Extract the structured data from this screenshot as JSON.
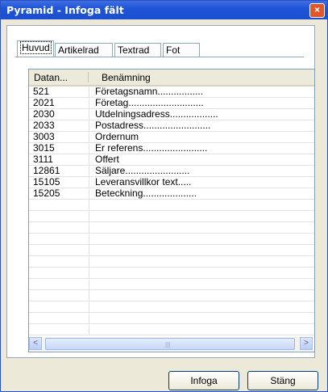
{
  "window": {
    "title": "Pyramid - Infoga fält",
    "close_label": "×"
  },
  "tabs": [
    {
      "label": "Huvud",
      "active": true
    },
    {
      "label": "Artikelrad",
      "active": false
    },
    {
      "label": "Textrad",
      "active": false
    },
    {
      "label": "Fot",
      "active": false
    }
  ],
  "table": {
    "headers": [
      "Datan...",
      "Benämning"
    ],
    "rows": [
      {
        "id": "521",
        "name": "Företagsnamn................."
      },
      {
        "id": "2021",
        "name": "Företag............................"
      },
      {
        "id": "2030",
        "name": "Utdelningsadress.................."
      },
      {
        "id": "2033",
        "name": "Postadress........................."
      },
      {
        "id": "3003",
        "name": "Ordernum"
      },
      {
        "id": "3015",
        "name": "Er referens........................"
      },
      {
        "id": "3111",
        "name": "Offert"
      },
      {
        "id": "12861",
        "name": "Säljare........................"
      },
      {
        "id": "15105",
        "name": "Leveransvillkor text....."
      },
      {
        "id": "15205",
        "name": "Beteckning...................."
      }
    ]
  },
  "scrollbar": {
    "left_arrow": "<",
    "right_arrow": ">",
    "grip": "|||"
  },
  "buttons": {
    "insert": "Infoga",
    "close": "Stäng"
  }
}
